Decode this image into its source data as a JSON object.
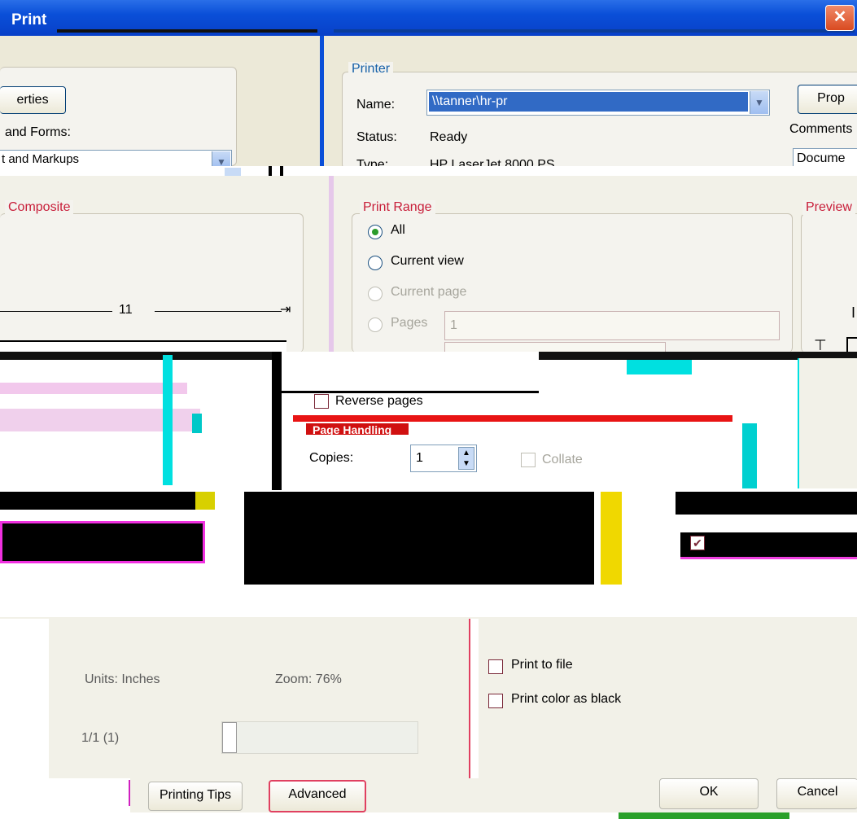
{
  "window": {
    "title": "Print",
    "close_glyph": "✕"
  },
  "left_top": {
    "properties_label": "erties",
    "forms_label": "and Forms:",
    "forms_value": "t and Markups"
  },
  "printer": {
    "legend": "Printer",
    "name_label": "Name:",
    "name_value": "\\\\tanner\\hr-pr",
    "status_label": "Status:",
    "status_value": "Ready",
    "type_label": "Type:",
    "type_value": "HP LaserJet 8000 PS",
    "properties_label": "Prop",
    "comments_label": "Comments",
    "comments_value": "Docume"
  },
  "composite": {
    "legend": "Composite",
    "width_label": "11"
  },
  "print_range": {
    "legend": "Print Range",
    "all_label": "All",
    "current_view_label": "Current view",
    "current_page_label": "Current page",
    "pages_label": "Pages",
    "pages_value": "1",
    "reverse_pages_label": "Reverse pages"
  },
  "preview": {
    "legend": "Preview"
  },
  "page_handling": {
    "legend": "Page Handling",
    "copies_label": "Copies:",
    "copies_value": "1",
    "collate_label": "Collate"
  },
  "options": {
    "print_to_file": "Print to file",
    "print_color_as_black": "Print color as black"
  },
  "footer": {
    "units_label": "Units: Inches",
    "zoom_label": "Zoom: 76%",
    "page_counter": "1/1 (1)",
    "printing_tips_label": "Printing Tips",
    "advanced_label": "Advanced",
    "ok_label": "OK",
    "cancel_label": "Cancel"
  }
}
